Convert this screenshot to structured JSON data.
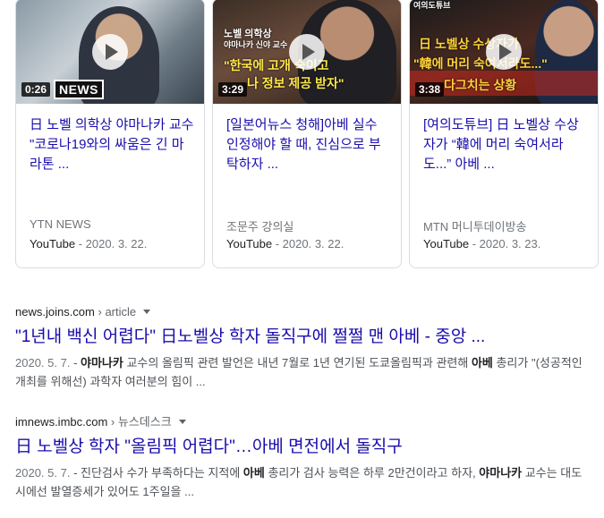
{
  "video_cards": [
    {
      "duration": "0:26",
      "badge": "NEWS",
      "overlay": [],
      "title": "日 노벨 의학상 야마나카 교수 \"코로나19와의 싸움은 긴 마라톤 ...",
      "source": "YTN NEWS",
      "platform": "YouTube",
      "date": "2020. 3. 22."
    },
    {
      "duration": "3:29",
      "badge": "",
      "overlay": [
        "노벨 의학상",
        "야마나카 신야 교수",
        "\"한국에 고개 숙이고",
        "나 정보 제공 받자\""
      ],
      "title": "[일본어뉴스 청해]아베 실수 인정해야 할 때, 진심으로 부탁하자 ...",
      "source": "조문주 강의실",
      "platform": "YouTube",
      "date": "2020. 3. 22."
    },
    {
      "duration": "3:38",
      "badge": "",
      "overlay": [
        "여의도튜브",
        "日 노벨상 수상자가",
        "\"韓에 머리 숙여서라도...\"",
        "다그치는 상황"
      ],
      "title": "[여의도튜브] 日 노벨상 수상자가 “韓에 머리 숙여서라도...” 아베 ...",
      "source": "MTN 머니투데이방송",
      "platform": "YouTube",
      "date": "2020. 3. 23."
    }
  ],
  "results": [
    {
      "domain": "news.joins.com",
      "sep": " › ",
      "path": "article",
      "title": "\"1년내 백신 어렵다\" 日노벨상 학자 돌직구에 쩔쩔 맨 아베 - 중앙 ...",
      "date": "2020. 5. 7.",
      "snippet_parts": [
        {
          "t": " - ",
          "b": false
        },
        {
          "t": "야마나카",
          "b": true
        },
        {
          "t": " 교수의 올림픽 관련 발언은 내년 7월로 1년 연기된 도쿄올림픽과 관련해 ",
          "b": false
        },
        {
          "t": "아베",
          "b": true
        },
        {
          "t": " 총리가 \"(성공적인 개최를 위해선) 과학자 여러분의 힘이 ...",
          "b": false
        }
      ]
    },
    {
      "domain": "imnews.imbc.com",
      "sep": " › ",
      "path": "뉴스데스크",
      "title": "日 노벨상 학자 \"올림픽 어렵다\"…아베 면전에서 돌직구",
      "date": "2020. 5. 7.",
      "snippet_parts": [
        {
          "t": " - 진단검사 수가 부족하다는 지적에 ",
          "b": false
        },
        {
          "t": "아베",
          "b": true
        },
        {
          "t": " 총리가 검사 능력은 하루 2만건이라고 하자, ",
          "b": false
        },
        {
          "t": "야마나카",
          "b": true
        },
        {
          "t": " 교수는 대도시에선 발열증세가 있어도 1주일을 ...",
          "b": false
        }
      ]
    }
  ],
  "colors": {
    "link": "#1a0dab",
    "meta": "#70757a",
    "snippet": "#4d5156",
    "border": "#dadce0"
  },
  "icons": {
    "play": "play-icon",
    "more": "caret-down-icon"
  }
}
